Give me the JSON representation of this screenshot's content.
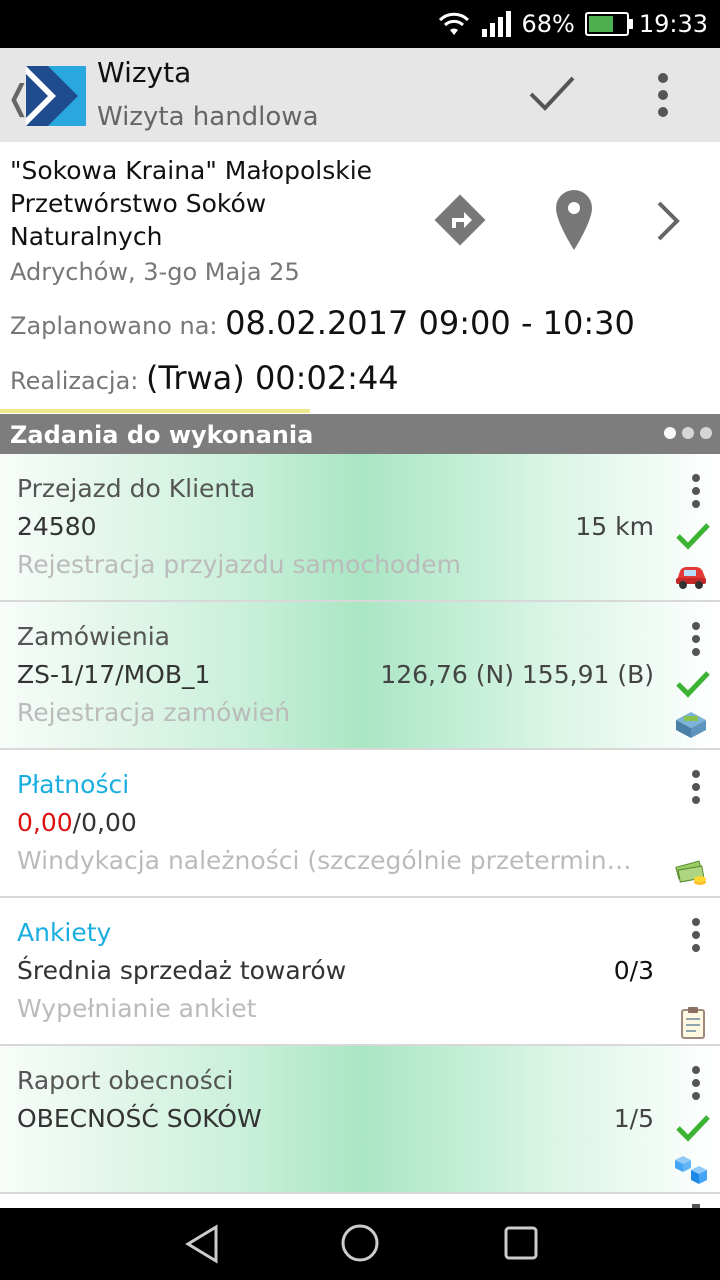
{
  "status_bar": {
    "battery": "68%",
    "time": "19:33",
    "battery_level": 0.68
  },
  "appbar": {
    "back_glyph": "❬",
    "title": "Wizyta",
    "subtitle": "Wizyta handlowa",
    "confirm_icon": "check-icon",
    "menu_icon": "more-vert-icon"
  },
  "visit": {
    "client_name": "\"Sokowa Kraina\" Małopolskie Przetwórstwo Soków Naturalnych",
    "address": "Adrychów, 3-go Maja 25",
    "planned_label": "Zaplanowano na:",
    "planned_value": "08.02.2017 09:00 - 10:30",
    "realization_label": "Realizacja:",
    "realization_value": "(Trwa) 00:02:44"
  },
  "section": {
    "title": "Zadania do wykonania"
  },
  "tasks": [
    {
      "title": "Przejazd do Klienta",
      "line2": "24580",
      "line2_right": "15 km",
      "desc": "Rejestracja przyjazdu samochodem",
      "done": true,
      "icon": "car-icon",
      "highlighted": true
    },
    {
      "title": "Zamówienia",
      "line2": "ZS-1/17/MOB_1",
      "line2_right": "126,76 (N) 155,91 (B)",
      "desc": "Rejestracja zamówień",
      "done": true,
      "icon": "order-icon",
      "highlighted": true
    },
    {
      "title": "Płatności",
      "amount_due": "0,00",
      "amount_total": "/0,00",
      "desc": "Windykacja należności (szczególnie przetermino…",
      "done": false,
      "icon": "money-icon",
      "highlighted": false
    },
    {
      "title": "Ankiety",
      "line2": "Średnia sprzedaż towarów",
      "line2_right": "0/3",
      "desc": "Wypełnianie ankiet",
      "done": false,
      "icon": "clipboard-icon",
      "highlighted": false
    },
    {
      "title": "Raport obecności",
      "line2": "OBECNOŚĆ SOKÓW",
      "line2_right": "1/5",
      "desc": "",
      "done": true,
      "icon": "boxes-icon",
      "highlighted": true
    }
  ],
  "colors": {
    "accent_blue": "#1aaee0",
    "check_green": "#3cb332",
    "due_red": "#dd1111",
    "header_grey": "#7d7d7d"
  }
}
